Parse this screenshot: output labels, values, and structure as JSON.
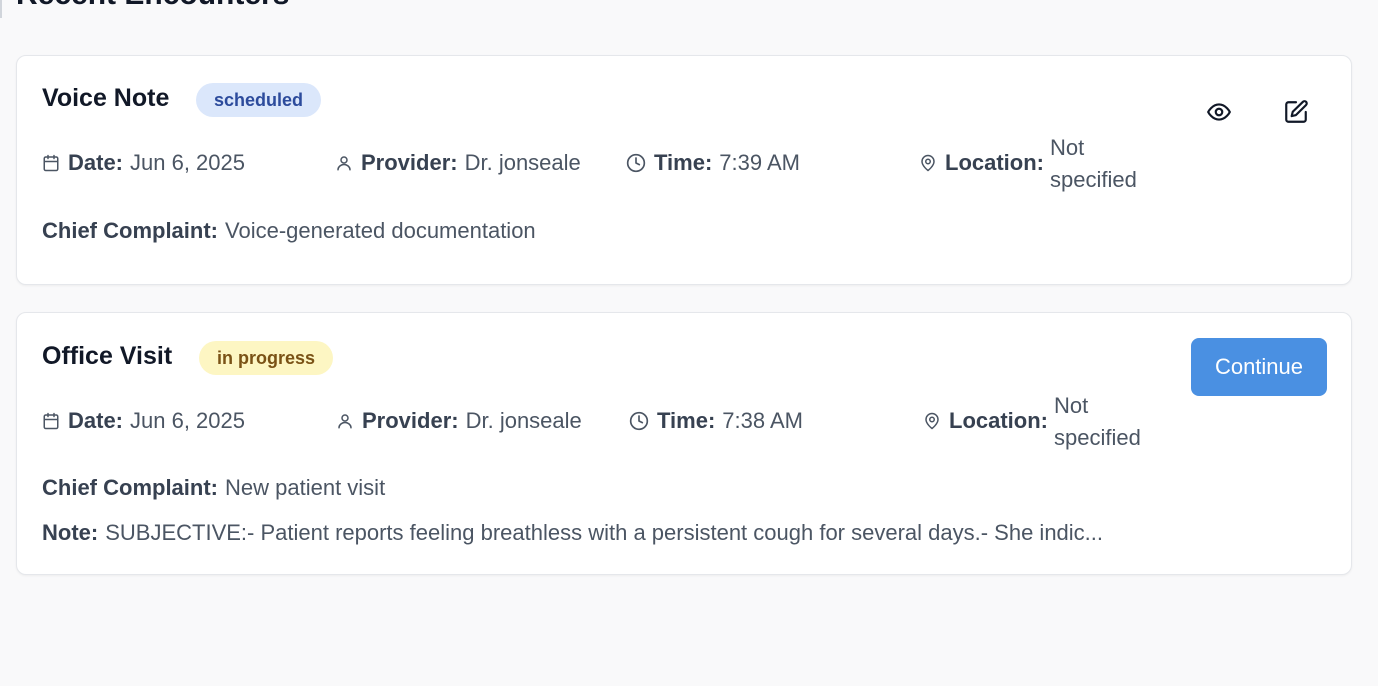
{
  "section": {
    "title": "Recent Encounters"
  },
  "labels": {
    "date": "Date:",
    "provider": "Provider:",
    "time": "Time:",
    "location": "Location:",
    "chief_complaint": "Chief Complaint:",
    "note": "Note:"
  },
  "encounters": [
    {
      "title": "Voice Note",
      "status": "scheduled",
      "date": "Jun 6, 2025",
      "provider": "Dr. jonseale",
      "time": "7:39 AM",
      "location_line1": "Not",
      "location_line2": "specified",
      "chief_complaint": "Voice-generated documentation",
      "actions": {
        "view_icon": "eye-icon",
        "edit_icon": "edit-icon"
      }
    },
    {
      "title": "Office Visit",
      "status": "in progress",
      "date": "Jun 6, 2025",
      "provider": "Dr. jonseale",
      "time": "7:38 AM",
      "location_line1": "Not",
      "location_line2": "specified",
      "chief_complaint": "New patient visit",
      "note": "SUBJECTIVE:- Patient reports feeling breathless with a persistent cough for several days.- She indic...",
      "actions": {
        "continue_label": "Continue"
      }
    }
  ],
  "colors": {
    "scheduled_bg": "#dbe7fb",
    "scheduled_text": "#2c4b9c",
    "in_progress_bg": "#fdf6c3",
    "in_progress_text": "#7a5216",
    "primary_button": "#4a90e2"
  }
}
